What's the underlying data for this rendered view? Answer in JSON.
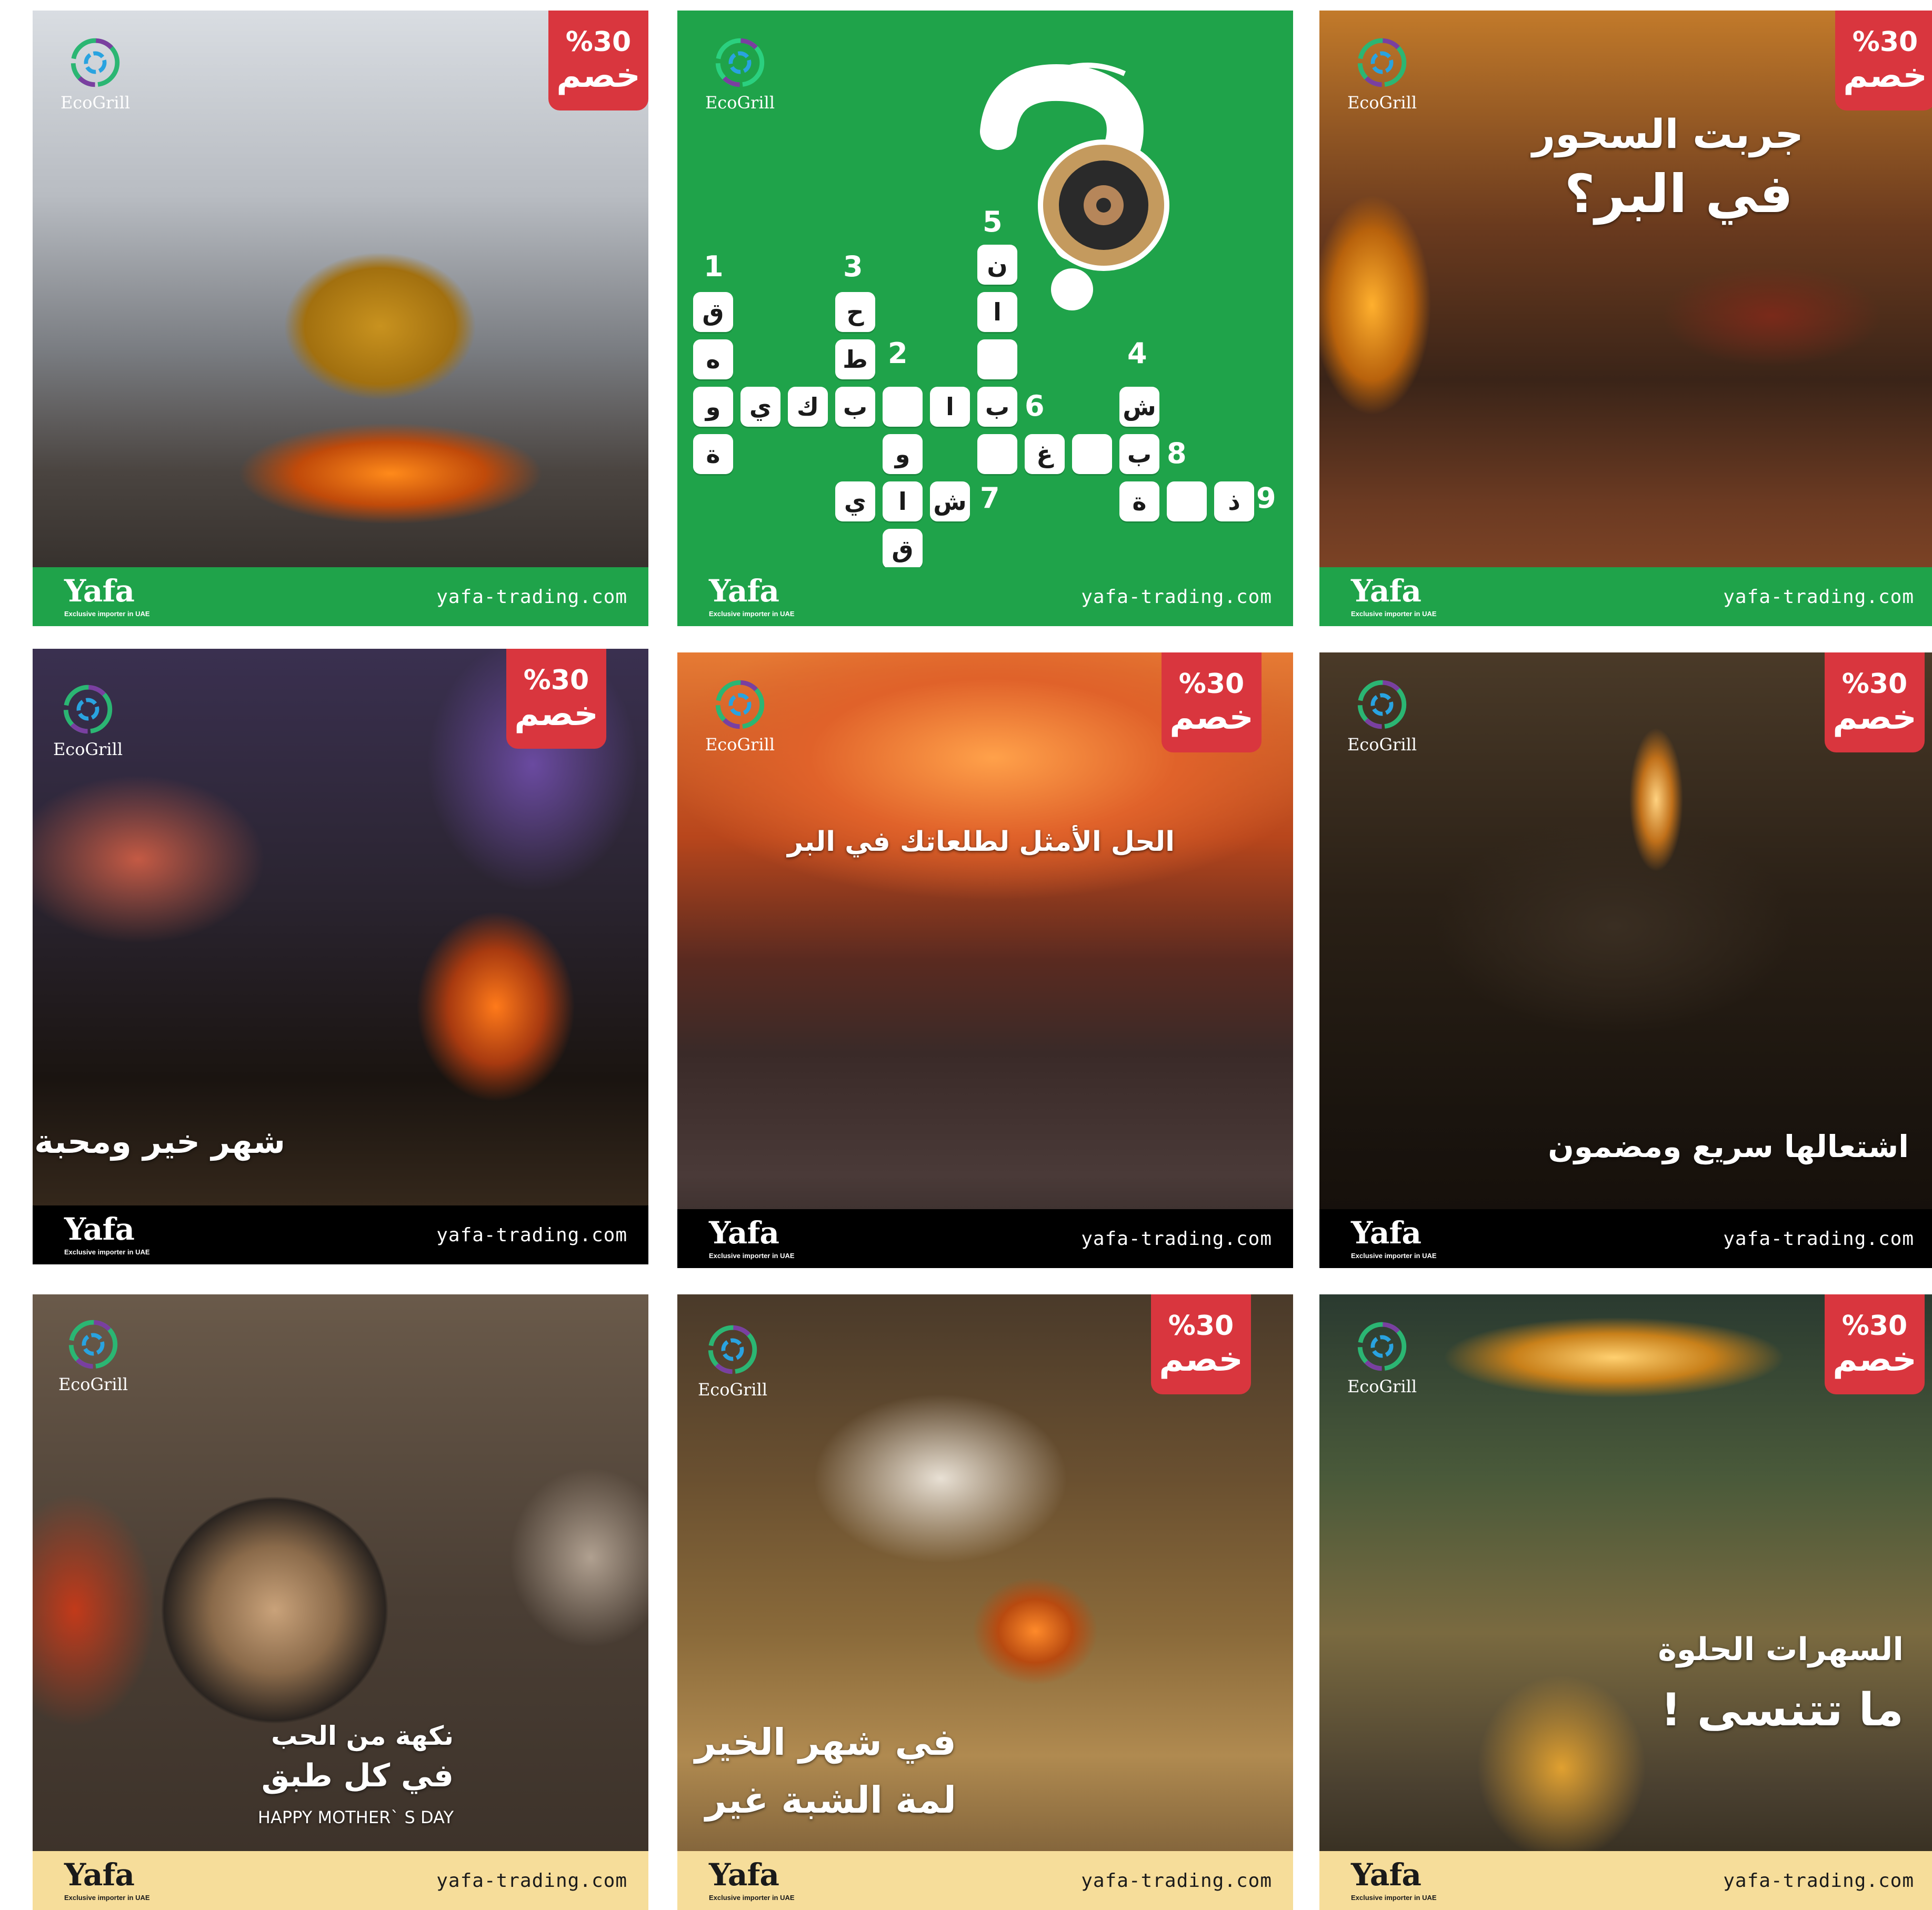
{
  "brand": {
    "eco_label": "EcoGrill",
    "yafa_logo": "Yafa",
    "yafa_sub": "Exclusive importer in UAE",
    "site": "yafa-trading.com",
    "discount_pct": "%30",
    "discount_word": "خصم"
  },
  "colors": {
    "green": "#1fa34a",
    "badge_red": "#d9363e",
    "cream": "#f6dd9a"
  },
  "tiles": {
    "t3": {
      "line1": "جربت السحور",
      "line2": "في البر؟"
    },
    "t4": {
      "caption": "شهر خير ومحبة"
    },
    "t5": {
      "caption": "الحل الأمثل لطلعاتك في البر"
    },
    "t6": {
      "caption": "اشتعالها سريع ومضمون"
    },
    "t7": {
      "line1": "نكهة من الحب",
      "line2": "في كل طبق",
      "line3": "HAPPY MOTHER` S DAY"
    },
    "t8": {
      "line1": "في شهر الخير",
      "line2": "لمة الشبة غير"
    },
    "t9": {
      "line1": "السهرات الحلوة",
      "line2": "ما تتنسى !"
    }
  },
  "crossword": {
    "numbers": [
      "1",
      "2",
      "3",
      "4",
      "5",
      "6",
      "7",
      "8",
      "9"
    ],
    "letters": {
      "c1a": "ق",
      "c1b": "ه",
      "c1c": "و",
      "c1d": "ة",
      "c3a": "ح",
      "c3b": "ط",
      "r2a": "و",
      "r2b": "ي",
      "r2c": "ك",
      "r2d": "ب",
      "r2e": "",
      "r2f": "ا",
      "r2g": "ب",
      "c2a": "و",
      "c5a": "ن",
      "c5b": "ا",
      "c5c": "",
      "r6a": "",
      "r6b": "غ",
      "r6c": "",
      "c4a": "ش",
      "c4b": "ب",
      "r7a": "ي",
      "r7b": "ا",
      "r7c": "ش",
      "r7d": "ق",
      "r9a": "ة",
      "r9b": "",
      "r9c": "ذ"
    }
  }
}
